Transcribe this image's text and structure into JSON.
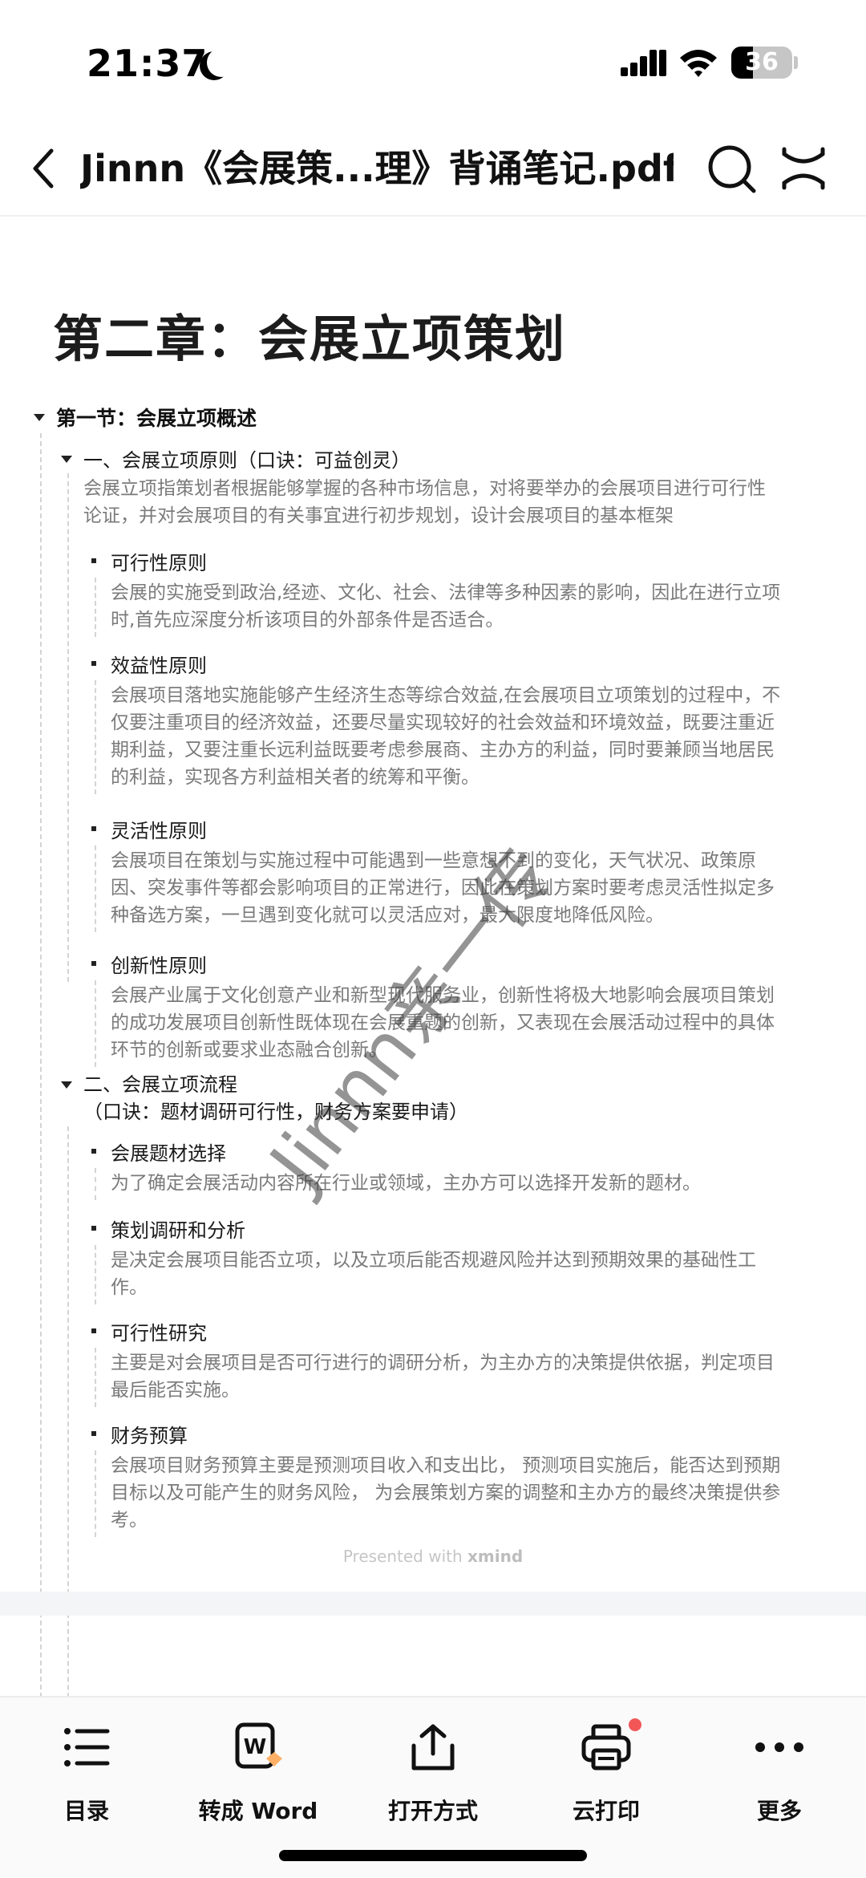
{
  "status_bar": {
    "time": "21:37",
    "battery": "36",
    "battery_level": 0.36
  },
  "nav": {
    "title": "Jinnn《会展策...理》背诵笔记.pdf"
  },
  "doc": {
    "chapter_title": "第二章：会展立项策划",
    "section1": {
      "title": "第一节：会展立项概述",
      "sub1": {
        "title": "一、会展立项原则（口诀：可益创灵）",
        "desc_line1": "会展立项指策划者根据能够掌握的各种市场信息，对将要举办的会展项目进行可行性",
        "desc_line2": "论证，并对会展项目的有关事宜进行初步规划，设计会展项目的基本框架",
        "items": [
          {
            "title": "可行性原则",
            "lines": [
              "会展的实施受到政治,经迹、文化、社会、法律等多种因素的影响，因此在进行立项",
              "时,首先应深度分析该项目的外部条件是否适合。"
            ]
          },
          {
            "title": "效益性原则",
            "lines": [
              "会展项目落地实施能够产生经济生态等综合效益,在会展项目立项策划的过程中，不",
              "仅要注重项目的经济效益，还要尽量实现较好的社会效益和环境效益，既要注重近",
              "期利益，又要注重长远利益既要考虑参展商、主办方的利益，同时要兼顾当地居民",
              "的利益，实现各方利益相关者的统筹和平衡。"
            ]
          },
          {
            "title": "灵活性原则",
            "lines": [
              "会展项目在策划与实施过程中可能遇到一些意想不到的变化，天气状况、政策原",
              "因、突发事件等都会影响项目的正常进行，因此在策划方案时要考虑灵活性拟定多",
              "种备选方案，一旦遇到变化就可以灵活应对，最大限度地降低风险。"
            ]
          },
          {
            "title": "创新性原则",
            "lines": [
              "会展产业属于文化创意产业和新型现代服务业，创新性将极大地影响会展项目策划",
              "的成功发展项目创新性既体现在会展重题的创新，又表现在会展活动过程中的具体",
              "环节的创新或要求业态融合创新。"
            ]
          }
        ]
      },
      "sub2": {
        "title": "二、会展立项流程",
        "title_line2": "（口诀：题材调研可行性，财务方案要申请）",
        "items": [
          {
            "title": "会展题材选择",
            "lines": [
              "为了确定会展活动内容所在行业或领域，主办方可以选择开发新的题材。"
            ]
          },
          {
            "title": "策划调研和分析",
            "lines": [
              "是决定会展项目能否立项，以及立项后能否规避风险并达到预期效果的基础性工",
              "作。"
            ]
          },
          {
            "title": "可行性研究",
            "lines": [
              "主要是对会展项目是否可行进行的调研分析，为主办方的决策提供依据，判定项目",
              "最后能否实施。"
            ]
          },
          {
            "title": "财务预算",
            "lines": [
              "会展项目财务预算主要是预测项目收入和支出比， 预测项目实施后，能否达到预期",
              "目标以及可能产生的财务风险， 为会展策划方案的调整和主办方的最终决策提供参",
              "考。"
            ]
          }
        ]
      }
    },
    "watermark": "Jinnn亲一传",
    "presented_prefix": "Presented with ",
    "presented_brand": "xmind"
  },
  "toolbar": {
    "items": [
      {
        "label": "目录",
        "icon": "list-icon"
      },
      {
        "label": "转成 Word",
        "icon": "word-convert-icon"
      },
      {
        "label": "打开方式",
        "icon": "share-icon"
      },
      {
        "label": "云打印",
        "icon": "printer-icon"
      },
      {
        "label": "更多",
        "icon": "more-icon"
      }
    ]
  },
  "colors": {
    "accent_dot": "#f25656",
    "body_text": "#7a7a7a"
  }
}
